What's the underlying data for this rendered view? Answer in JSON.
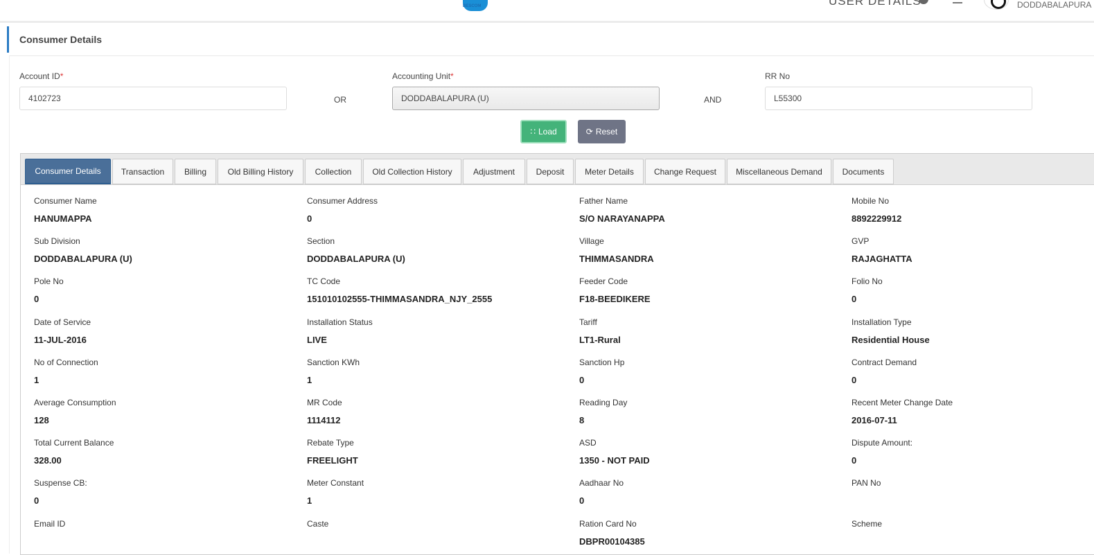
{
  "header": {
    "logo_text": "BESCOM",
    "user_details": "USER DETAILS",
    "username": "DODDABALAPURA"
  },
  "panel": {
    "title": "Consumer Details"
  },
  "form": {
    "account_id": {
      "label": "Account ID",
      "req": "*",
      "value": "4102723"
    },
    "or": "OR",
    "accounting_unit": {
      "label": "Accounting Unit",
      "req": "*",
      "value": "DODDABALAPURA (U)"
    },
    "and": "AND",
    "rr_no": {
      "label": "RR No",
      "value": "L55300"
    },
    "load": "Load",
    "reset": "Reset"
  },
  "tabs": [
    "Consumer Details",
    "Transaction",
    "Billing",
    "Old Billing History",
    "Collection",
    "Old Collection History",
    "Adjustment",
    "Deposit",
    "Meter Details",
    "Change Request",
    "Miscellaneous Demand",
    "Documents"
  ],
  "fields": [
    {
      "k": "Consumer Name",
      "v": "HANUMAPPA"
    },
    {
      "k": "Consumer Address",
      "v": "0"
    },
    {
      "k": "Father Name",
      "v": "S/O NARAYANAPPA"
    },
    {
      "k": "Mobile No",
      "v": "8892229912"
    },
    {
      "k": "Sub Division",
      "v": "DODDABALAPURA (U)"
    },
    {
      "k": "Section",
      "v": "DODDABALAPURA (U)"
    },
    {
      "k": "Village",
      "v": "THIMMASANDRA"
    },
    {
      "k": "GVP",
      "v": "RAJAGHATTA"
    },
    {
      "k": "Pole No",
      "v": "0"
    },
    {
      "k": "TC Code",
      "v": "151010102555-THIMMASANDRA_NJY_2555"
    },
    {
      "k": "Feeder Code",
      "v": "F18-BEEDIKERE"
    },
    {
      "k": "Folio No",
      "v": "0"
    },
    {
      "k": "Date of Service",
      "v": "11-JUL-2016"
    },
    {
      "k": "Installation Status",
      "v": "LIVE"
    },
    {
      "k": "Tariff",
      "v": "LT1-Rural"
    },
    {
      "k": "Installation Type",
      "v": "Residential House"
    },
    {
      "k": "No of Connection",
      "v": "1"
    },
    {
      "k": "Sanction KWh",
      "v": "1"
    },
    {
      "k": "Sanction Hp",
      "v": "0"
    },
    {
      "k": "Contract Demand",
      "v": "0"
    },
    {
      "k": "Average Consumption",
      "v": "128"
    },
    {
      "k": "MR Code",
      "v": "1114112"
    },
    {
      "k": "Reading Day",
      "v": "8"
    },
    {
      "k": "Recent Meter Change Date",
      "v": "2016-07-11"
    },
    {
      "k": "Total Current Balance",
      "v": "328.00"
    },
    {
      "k": "Rebate Type",
      "v": "FREELIGHT"
    },
    {
      "k": "ASD",
      "v": "1350 - NOT PAID"
    },
    {
      "k": "Dispute Amount:",
      "v": "0"
    },
    {
      "k": "Suspense CB:",
      "v": "0"
    },
    {
      "k": "Meter Constant",
      "v": "1"
    },
    {
      "k": "Aadhaar No",
      "v": "0"
    },
    {
      "k": "PAN No",
      "v": ""
    },
    {
      "k": "Email ID",
      "v": ""
    },
    {
      "k": "Caste",
      "v": ""
    },
    {
      "k": "Ration Card No",
      "v": "DBPR00104385"
    },
    {
      "k": "Scheme",
      "v": ""
    }
  ]
}
